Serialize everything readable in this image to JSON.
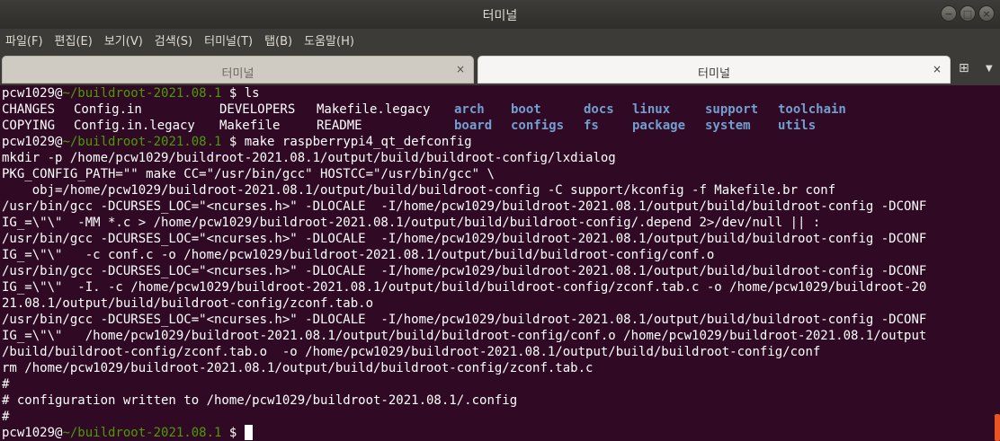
{
  "window": {
    "title": "터미널",
    "buttons": {
      "minimize": "−",
      "maximize": "□",
      "close": "×"
    }
  },
  "menu": [
    "파일(F)",
    "편집(E)",
    "보기(V)",
    "검색(S)",
    "터미널(T)",
    "탭(B)",
    "도움말(H)"
  ],
  "tabs": [
    {
      "label": "터미널",
      "close": "×",
      "active": false
    },
    {
      "label": "터미널",
      "close": "×",
      "active": true
    }
  ],
  "tabbar": {
    "new_tab_icon": "⊞",
    "dropdown_icon": "▼"
  },
  "prompt": {
    "user": "pcw1029@",
    "path": "~/buildroot-2021.08.1",
    "symbol": " $ "
  },
  "commands": [
    "ls",
    "make raspberrypi4_qt_defconfig"
  ],
  "ls_files_row1": [
    "CHANGES",
    "Config.in",
    "DEVELOPERS",
    "Makefile.legacy"
  ],
  "ls_dirs_row1": [
    "arch",
    "boot",
    "docs",
    "linux",
    "support",
    "toolchain"
  ],
  "ls_files_row2": [
    "COPYING",
    "Config.in.legacy",
    "Makefile",
    "README"
  ],
  "ls_dirs_row2": [
    "board",
    "configs",
    "fs",
    "package",
    "system",
    "utils"
  ],
  "output": [
    "mkdir -p /home/pcw1029/buildroot-2021.08.1/output/build/buildroot-config/lxdialog",
    "PKG_CONFIG_PATH=\"\" make CC=\"/usr/bin/gcc\" HOSTCC=\"/usr/bin/gcc\" \\",
    "    obj=/home/pcw1029/buildroot-2021.08.1/output/build/buildroot-config -C support/kconfig -f Makefile.br conf",
    "/usr/bin/gcc -DCURSES_LOC=\"<ncurses.h>\" -DLOCALE  -I/home/pcw1029/buildroot-2021.08.1/output/build/buildroot-config -DCONF",
    "IG_=\\\"\\\"  -MM *.c > /home/pcw1029/buildroot-2021.08.1/output/build/buildroot-config/.depend 2>/dev/null || :",
    "/usr/bin/gcc -DCURSES_LOC=\"<ncurses.h>\" -DLOCALE  -I/home/pcw1029/buildroot-2021.08.1/output/build/buildroot-config -DCONF",
    "IG_=\\\"\\\"   -c conf.c -o /home/pcw1029/buildroot-2021.08.1/output/build/buildroot-config/conf.o",
    "/usr/bin/gcc -DCURSES_LOC=\"<ncurses.h>\" -DLOCALE  -I/home/pcw1029/buildroot-2021.08.1/output/build/buildroot-config -DCONF",
    "IG_=\\\"\\\"  -I. -c /home/pcw1029/buildroot-2021.08.1/output/build/buildroot-config/zconf.tab.c -o /home/pcw1029/buildroot-20",
    "21.08.1/output/build/buildroot-config/zconf.tab.o",
    "/usr/bin/gcc -DCURSES_LOC=\"<ncurses.h>\" -DLOCALE  -I/home/pcw1029/buildroot-2021.08.1/output/build/buildroot-config -DCONF",
    "IG_=\\\"\\\"   /home/pcw1029/buildroot-2021.08.1/output/build/buildroot-config/conf.o /home/pcw1029/buildroot-2021.08.1/output",
    "/build/buildroot-config/zconf.tab.o  -o /home/pcw1029/buildroot-2021.08.1/output/build/buildroot-config/conf",
    "rm /home/pcw1029/buildroot-2021.08.1/output/build/buildroot-config/zconf.tab.c",
    "#",
    "# configuration written to /home/pcw1029/buildroot-2021.08.1/.config",
    "#"
  ],
  "colors": {
    "terminal_bg": "#300a24",
    "prompt_path": "#4e9a06",
    "directory": "#729fcf",
    "text": "#ffffff",
    "accent": "#e95420"
  }
}
